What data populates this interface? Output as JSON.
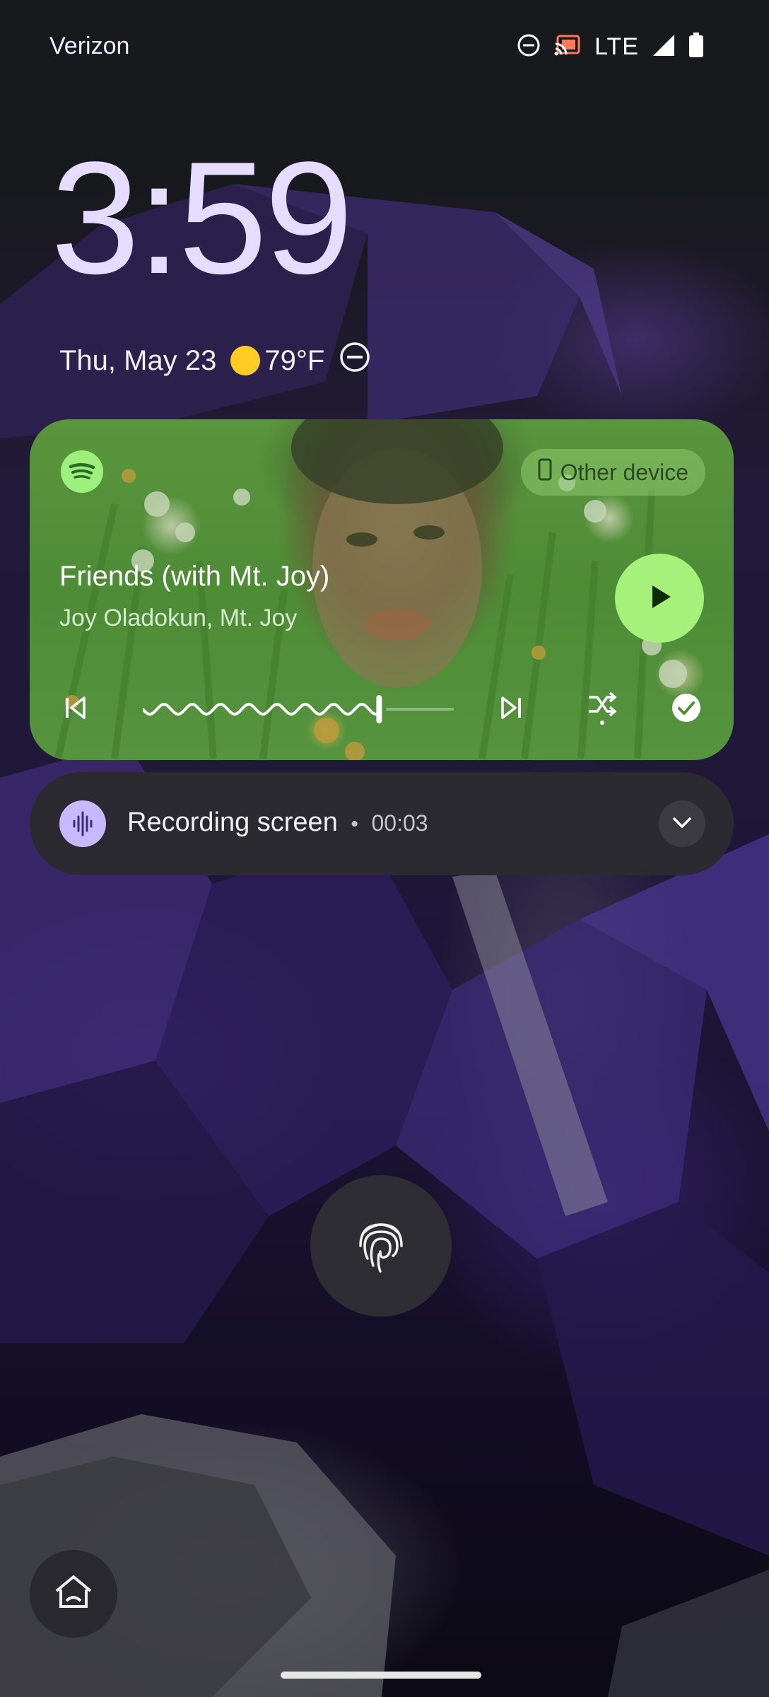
{
  "status_bar": {
    "carrier": "Verizon",
    "network": "LTE",
    "icons": [
      "do-not-disturb-icon",
      "cast-icon",
      "lte-label",
      "signal-icon",
      "battery-icon"
    ]
  },
  "lockscreen": {
    "time": "3:59",
    "date": "Thu, May 23",
    "temperature": "79°F",
    "weather_icon": "sun-icon",
    "dnd_icon": "do-not-disturb-icon"
  },
  "media_player": {
    "app_icon": "spotify-icon",
    "output_device": "Other device",
    "track_title": "Friends (with Mt. Joy)",
    "artist": "Joy Oladokun, Mt. Joy",
    "progress_fraction": 0.76,
    "controls": [
      "previous-icon",
      "next-icon",
      "shuffle-icon",
      "checkmark-icon"
    ],
    "play_icon": "play-icon",
    "accent_color": "#a6f07c"
  },
  "recording_notification": {
    "title": "Recording screen",
    "separator": "•",
    "elapsed": "00:03",
    "icon": "sound-wave-icon",
    "accent_color": "#c8b8ff"
  },
  "unlock": {
    "icon": "fingerprint-icon"
  },
  "shortcuts": {
    "left_icon": "home-icon"
  }
}
